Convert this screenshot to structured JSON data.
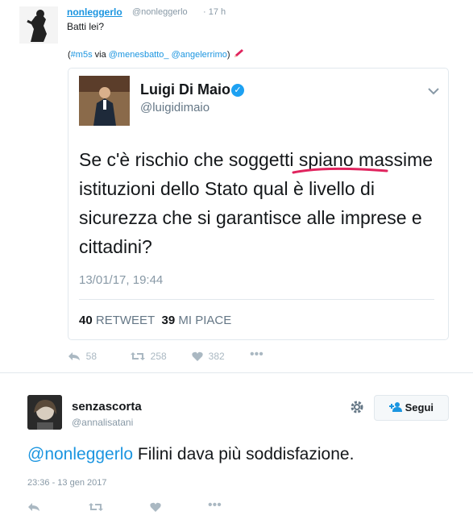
{
  "tweet1": {
    "name": "nonleggerlo",
    "handle": "@nonleggerlo",
    "time": "· 17 h",
    "text": "Batti lei?",
    "meta_open": "(",
    "hashtag": "#m5s",
    "via": " via ",
    "mention1": "@menesbatto_",
    "mention2": "@angelerrimo",
    "meta_close": ")",
    "actions": {
      "reply": "58",
      "retweet": "258",
      "like": "382"
    }
  },
  "quote": {
    "name": "Luigi Di Maio",
    "handle": "@luigidimaio",
    "text": "Se c'è rischio che soggetti spiano massime istituzioni dello Stato qual è livello di sicurezza che si garantisce alle imprese e cittadini?",
    "date": "13/01/17, 19:44",
    "retweets_count": "40",
    "retweets_label": "RETWEET",
    "likes_count": "39",
    "likes_label": "MI PIACE"
  },
  "tweet2": {
    "name": "senzascorta",
    "handle": "@annalisatani",
    "follow_label": "Segui",
    "mention": "@nonleggerlo",
    "text": " Filini dava più soddisfazione.",
    "date": "23:36 - 13 gen 2017"
  },
  "colors": {
    "link": "#1b95e0",
    "verified": "#1da1f2",
    "underline": "#e0245e"
  },
  "icons": [
    "reply-icon",
    "retweet-icon",
    "like-icon",
    "more-icon",
    "gear-icon",
    "follow-icon",
    "verified-icon",
    "chevron-down-icon",
    "pencil-icon"
  ]
}
